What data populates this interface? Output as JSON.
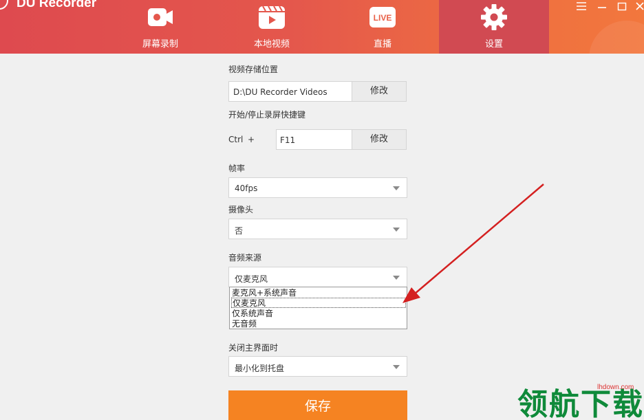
{
  "app": {
    "title": "DU Recorder"
  },
  "nav": [
    {
      "label": "屏幕录制",
      "icon": "camera-icon"
    },
    {
      "label": "本地视频",
      "icon": "video-folder-icon"
    },
    {
      "label": "直播",
      "icon": "live-icon",
      "badge": "LIVE"
    },
    {
      "label": "设置",
      "icon": "gear-icon",
      "active": true
    }
  ],
  "window_controls": [
    "menu-icon",
    "minimize-icon",
    "maximize-icon",
    "close-icon"
  ],
  "settings": {
    "storage": {
      "label": "视频存储位置",
      "value": "D:\\DU Recorder Videos",
      "button": "修改"
    },
    "hotkey": {
      "label": "开始/停止录屏快捷键",
      "modifier": "Ctrl",
      "plus": "+",
      "value": "F11",
      "button": "修改"
    },
    "framerate": {
      "label": "帧率",
      "value": "40fps"
    },
    "camera": {
      "label": "摄像头",
      "value": "否"
    },
    "audio": {
      "label": "音频来源",
      "value": "仅麦克风",
      "options": [
        "麦克风+系统声音",
        "仅麦克风",
        "仅系统声音",
        "无音频"
      ],
      "highlighted": "仅麦克风"
    },
    "close_main": {
      "label": "关闭主界面时",
      "value": "最小化到托盘"
    },
    "save": "保存"
  },
  "watermark": {
    "site": "lhdown.com",
    "brand": "领航下载"
  },
  "colors": {
    "header_start": "#de4a4f",
    "header_end": "#f2773d",
    "active_tab": "#d14a52",
    "save": "#f58322",
    "arrow": "#d42020"
  }
}
